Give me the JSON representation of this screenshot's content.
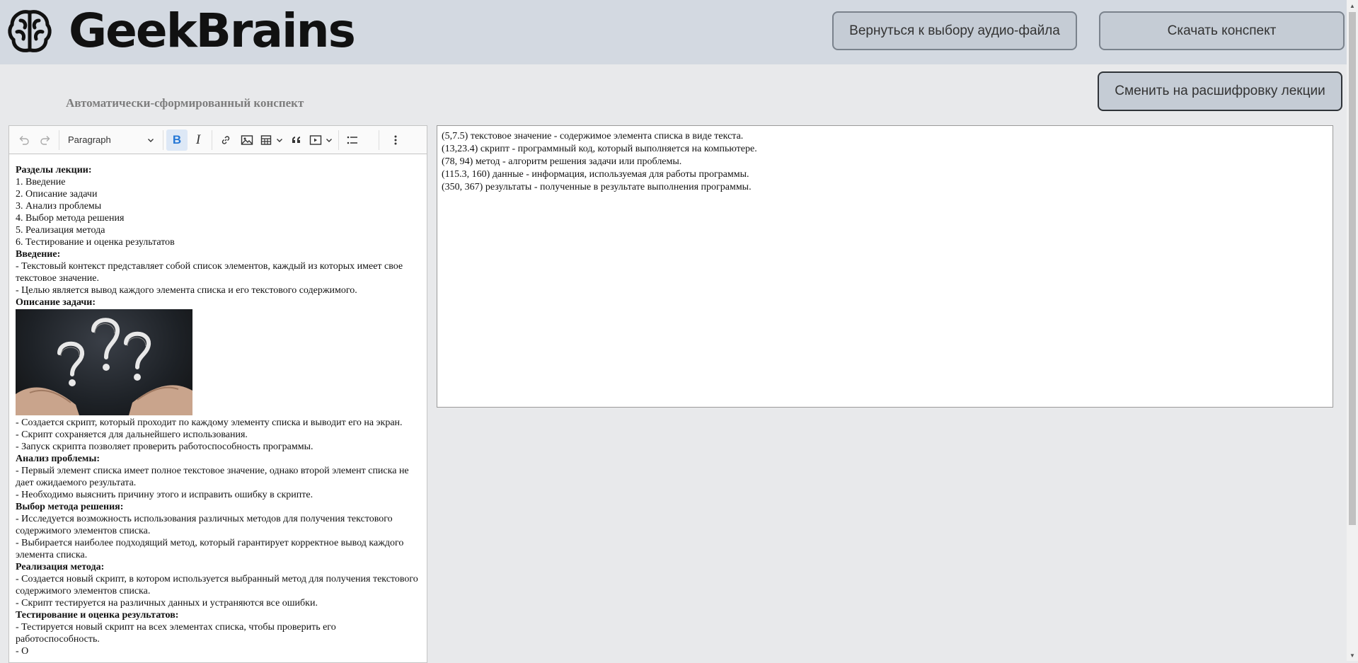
{
  "header": {
    "logo_text": "GeekBrains",
    "back_button": "Вернуться к выбору аудио-файла",
    "download_button": "Скачать конспект"
  },
  "switch_button": "Сменить на расшифровку лекции",
  "subtitle": "Автоматически-сформированный конспект",
  "toolbar": {
    "paragraph_select": "Paragraph",
    "icons": [
      "undo-icon",
      "redo-icon",
      "bold-icon",
      "italic-icon",
      "link-icon",
      "image-icon",
      "table-icon",
      "quote-icon",
      "media-icon",
      "bulleted-list-icon",
      "more-icon"
    ]
  },
  "editor": {
    "intro_heading": "Разделы лекции:",
    "sections": [
      "1. Введение",
      "2. Описание задачи",
      "3. Анализ проблемы",
      "4. Выбор метода решения",
      "5. Реализация метода",
      "6. Тестирование и оценка результатов"
    ],
    "blocks1": [
      {
        "heading": "Введение:",
        "lines": [
          "- Текстовый контекст представляет собой список элементов, каждый из которых имеет свое текстовое значение.",
          "- Целью является вывод каждого элемента списка и его текстового содержимого."
        ]
      }
    ],
    "task_heading": "Описание задачи:",
    "task_lines": [
      "- Создается скрипт, который проходит по каждому элементу списка и выводит его на экран.",
      "- Скрипт сохраняется для дальнейшего использования.",
      "- Запуск скрипта позволяет проверить работоспособность программы."
    ],
    "blocks2": [
      {
        "heading": "Анализ проблемы:",
        "lines": [
          "- Первый элемент списка имеет полное текстовое значение, однако второй элемент списка не дает ожидаемого результата.",
          "- Необходимо выяснить причину этого и исправить ошибку в скрипте."
        ]
      },
      {
        "heading": "Выбор метода решения:",
        "lines": [
          "- Исследуется возможность использования различных методов для получения текстового содержимого элементов списка.",
          "- Выбирается наиболее подходящий метод, который гарантирует корректное вывод каждого элемента списка."
        ]
      },
      {
        "heading": "Реализация метода:",
        "lines": [
          "- Создается новый скрипт, в котором используется выбранный метод для получения текстового содержимого элементов списка.",
          "- Скрипт тестируется на различных данных и устраняются все ошибки."
        ]
      },
      {
        "heading": "Тестирование и оценка результатов:",
        "lines": [
          "- Тестируется новый скрипт на всех элементах списка, чтобы проверить его работоспособность.",
          "- О"
        ]
      }
    ]
  },
  "transcript": [
    "(5,7.5) текстовое значение - содержимое элемента списка в виде текста.",
    "(13,23.4) скрипт - программный код, который выполняется на компьютере.",
    "(78, 94) метод - алгоритм решения задачи или проблемы.",
    "(115.3, 160) данные - информация, используемая для работы программы.",
    "(350, 367) результаты - полученные в результате выполнения программы."
  ]
}
